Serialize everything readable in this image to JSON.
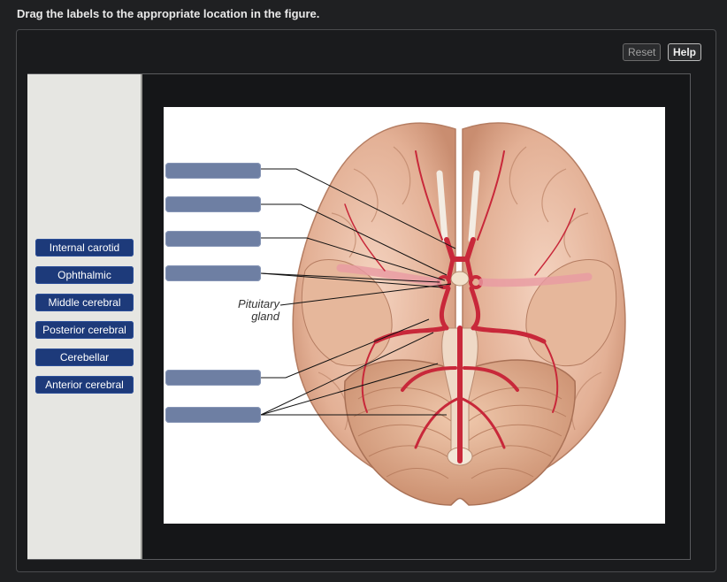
{
  "instruction": "Drag the labels to the appropriate location in the figure.",
  "toolbar": {
    "reset_label": "Reset",
    "help_label": "Help"
  },
  "label_bank": [
    "Internal carotid",
    "Ophthalmic",
    "Middle cerebral",
    "Posterior cerebral",
    "Cerebellar",
    "Anterior cerebral"
  ],
  "figure": {
    "pituitary_label_line1": "Pituitary",
    "pituitary_label_line2": "gland"
  },
  "colors": {
    "label_chip": "#1d3a7a",
    "drop_target": "#6e7fa3",
    "artery": "#c8283a",
    "brain_tissue": "#e8b8a0"
  }
}
